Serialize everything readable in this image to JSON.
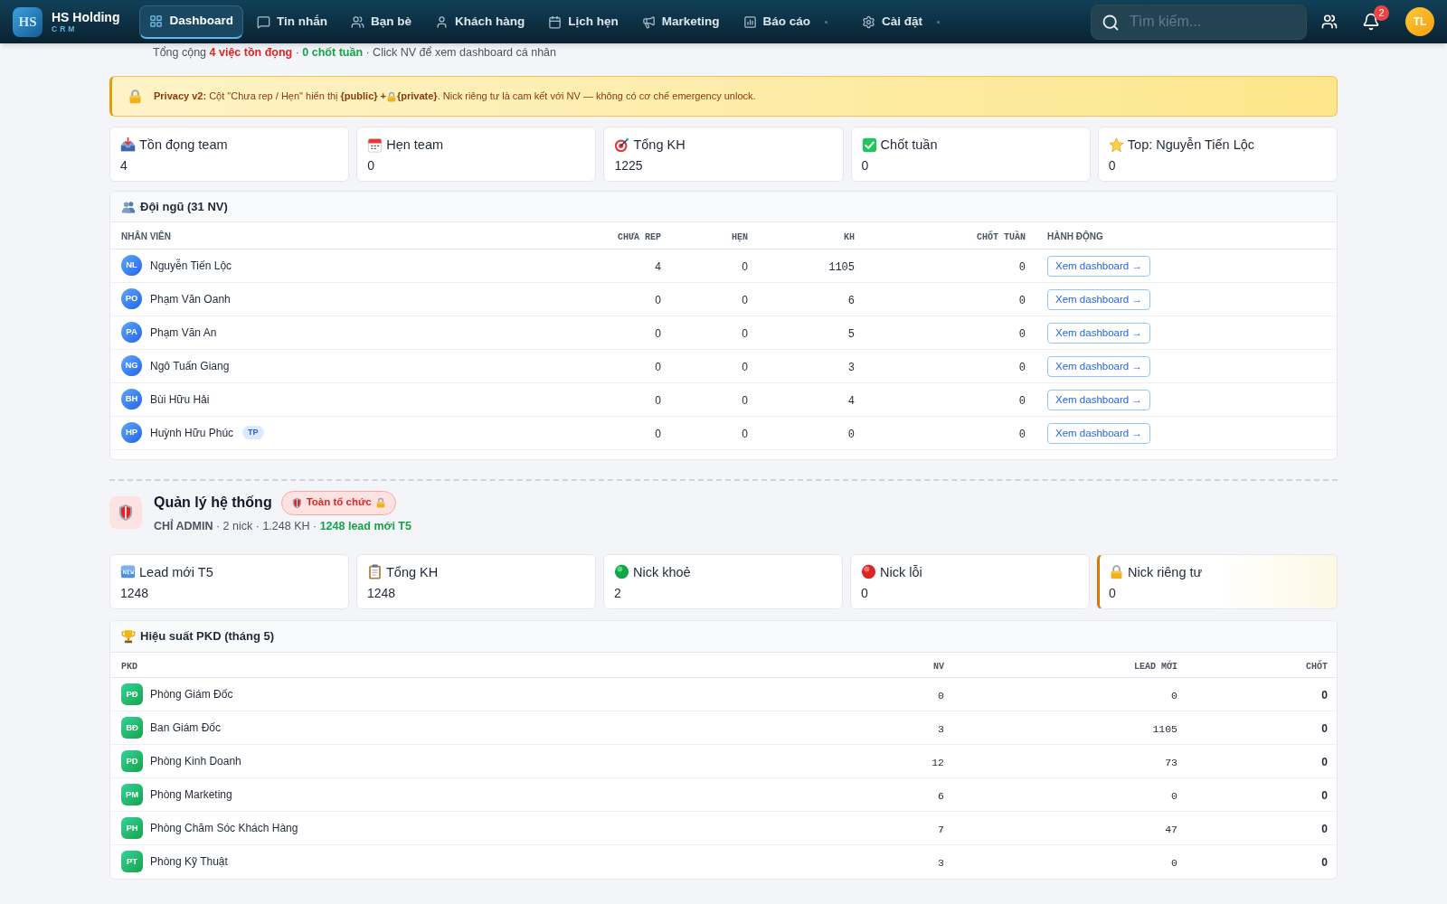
{
  "nav": {
    "logo_mark": "HS",
    "brand": "HS Holding",
    "brand_subtitle": "CRM",
    "items": [
      {
        "label": "Dashboard",
        "selected": true,
        "menu": false
      },
      {
        "label": "Tin nhắn",
        "selected": false,
        "menu": false
      },
      {
        "label": "Bạn bè",
        "selected": false,
        "menu": false
      },
      {
        "label": "Khách hàng",
        "selected": false,
        "menu": false
      },
      {
        "label": "Lịch hẹn",
        "selected": false,
        "menu": false
      },
      {
        "label": "Marketing",
        "selected": false,
        "menu": false
      },
      {
        "label": "Báo cáo",
        "selected": false,
        "menu": true
      },
      {
        "label": "Cài đặt",
        "selected": false,
        "menu": true
      }
    ],
    "search": {
      "placeholder": "Tìm kiếm..."
    },
    "notification_count": "2",
    "user_initials": "TL"
  },
  "team": {
    "summary": [
      {
        "text": "Tổng cộng ",
        "kind": "normal"
      },
      {
        "text": "4 việc tồn đọng",
        "kind": "alert"
      },
      {
        "text": " · ",
        "kind": "normal"
      },
      {
        "text": "0 chốt tuần",
        "kind": "success"
      },
      {
        "text": " · Click NV để xem dashboard cá nhân",
        "kind": "normal"
      }
    ],
    "notice": {
      "before_icon": "**Privacy v2:** Cột \"Chưa rep / Hẹn\" hiển thị **{public} +**",
      "after_icon": "**{private}**. Nick riêng tư là cam kết với NV — không có cơ chế emergency unlock."
    },
    "stats": [
      {
        "label": "Tồn đọng team",
        "value": "4"
      },
      {
        "label": "Hẹn team",
        "value": "0"
      },
      {
        "label": "Tổng KH",
        "value": "1225"
      },
      {
        "label": "Chốt tuần",
        "value": "0"
      },
      {
        "label": "Top: Nguyễn Tiến Lộc",
        "value": "0"
      }
    ],
    "table": {
      "title": "Đội ngũ (31 NV)",
      "columns": [
        "NHÂN VIÊN",
        "CHƯA REP",
        "HẸN",
        "KH",
        "CHỐT TUẦN",
        "HÀNH ĐỘNG"
      ],
      "rows": [
        {
          "initials": "NL",
          "name": "Nguyễn Tiến Lộc",
          "values": [
            "4",
            "0",
            "1105",
            "0"
          ],
          "action": "Xem dashboard →"
        },
        {
          "initials": "PO",
          "name": "Phạm Văn Oanh",
          "values": [
            "0",
            "0",
            "6",
            "0"
          ],
          "action": "Xem dashboard →"
        },
        {
          "initials": "PA",
          "name": "Phạm Văn An",
          "values": [
            "0",
            "0",
            "5",
            "0"
          ],
          "action": "Xem dashboard →"
        },
        {
          "initials": "NG",
          "name": "Ngô Tuấn Giang",
          "values": [
            "0",
            "0",
            "3",
            "0"
          ],
          "action": "Xem dashboard →"
        },
        {
          "initials": "BH",
          "name": "Bùi Hữu Hải",
          "values": [
            "0",
            "0",
            "4",
            "0"
          ],
          "action": "Xem dashboard →"
        },
        {
          "initials": "HP",
          "name": "Huỳnh Hữu Phúc",
          "tag": "TP",
          "values": [
            "0",
            "0",
            "0",
            "0"
          ],
          "action": "Xem dashboard →"
        }
      ]
    }
  },
  "admin": {
    "title": "Quản lý hệ thống",
    "scope": "Toàn tổ chức",
    "summary": [
      {
        "text": "CHỈ ADMIN",
        "kind": "emphasis"
      },
      {
        "text": " · 2 nick · 1.248 KH · ",
        "kind": "normal"
      },
      {
        "text": "1248 lead mới T5",
        "kind": "success"
      }
    ],
    "stats": [
      {
        "label": "Lead mới T5",
        "value": "1248",
        "highlighted": false
      },
      {
        "label": "Tổng KH",
        "value": "1248",
        "highlighted": false
      },
      {
        "label": "Nick khoẻ",
        "value": "2",
        "highlighted": false
      },
      {
        "label": "Nick lỗi",
        "value": "0",
        "highlighted": false
      },
      {
        "label": "Nick riêng tư",
        "value": "0",
        "highlighted": true
      }
    ],
    "table": {
      "title": "Hiệu suất PKD (tháng 5)",
      "columns": [
        "PKD",
        "NV",
        "LEAD MỚI",
        "CHỐT"
      ],
      "rows": [
        {
          "initials": "PĐ",
          "name": "Phòng Giám Đốc",
          "values": [
            "0",
            "0",
            "0"
          ]
        },
        {
          "initials": "BĐ",
          "name": "Ban Giám Đốc",
          "values": [
            "3",
            "1105",
            "0"
          ]
        },
        {
          "initials": "PD",
          "name": "Phòng Kinh Doanh",
          "values": [
            "12",
            "73",
            "0"
          ]
        },
        {
          "initials": "PM",
          "name": "Phòng Marketing",
          "values": [
            "6",
            "0",
            "0"
          ]
        },
        {
          "initials": "PH",
          "name": "Phòng Chăm Sóc Khách Hàng",
          "values": [
            "7",
            "47",
            "0"
          ]
        },
        {
          "initials": "PT",
          "name": "Phòng Kỹ Thuật",
          "values": [
            "3",
            "0",
            "0"
          ]
        }
      ]
    }
  }
}
